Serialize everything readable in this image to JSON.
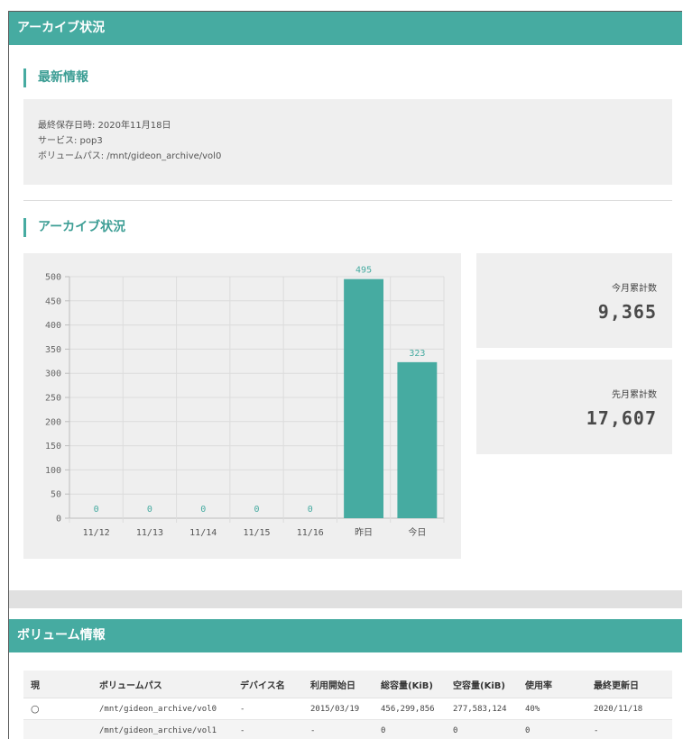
{
  "archive_section": {
    "title": "アーカイブ状況",
    "latest": {
      "heading": "最新情報",
      "last_saved": "最終保存日時: 2020年11月18日",
      "service": "サービス: pop3",
      "volume_path": "ボリュームパス: /mnt/gideon_archive/vol0"
    },
    "status_heading": "アーカイブ状況",
    "stats": {
      "this_month_label": "今月累計数",
      "this_month_value": "9,365",
      "last_month_label": "先月累計数",
      "last_month_value": "17,607"
    }
  },
  "chart_data": {
    "type": "bar",
    "categories": [
      "11/12",
      "11/13",
      "11/14",
      "11/15",
      "11/16",
      "昨日",
      "今日"
    ],
    "values": [
      0,
      0,
      0,
      0,
      0,
      495,
      323
    ],
    "ylim": [
      0,
      500
    ],
    "yticks": [
      0,
      50,
      100,
      150,
      200,
      250,
      300,
      350,
      400,
      450,
      500
    ],
    "ytick_labels": [
      "0",
      "50",
      "100",
      "150",
      "200",
      "250",
      "300",
      "350",
      "400",
      "450",
      "500"
    ],
    "grid": true,
    "bar_color": "#46aba1",
    "label_color": "#46aba1"
  },
  "volume_section": {
    "title": "ボリューム情報",
    "columns": [
      "現",
      "ボリュームパス",
      "デバイス名",
      "利用開始日",
      "総容量(KiB)",
      "空容量(KiB)",
      "使用率",
      "最終更新日"
    ],
    "rows": [
      [
        "○",
        "/mnt/gideon_archive/vol0",
        "-",
        "2015/03/19",
        "456,299,856",
        "277,583,124",
        "40%",
        "2020/11/18"
      ],
      [
        "",
        "/mnt/gideon_archive/vol1",
        "-",
        "-",
        "0",
        "0",
        "0",
        "-"
      ]
    ]
  },
  "colors": {
    "accent": "#46aba1",
    "panel": "#efefef"
  }
}
